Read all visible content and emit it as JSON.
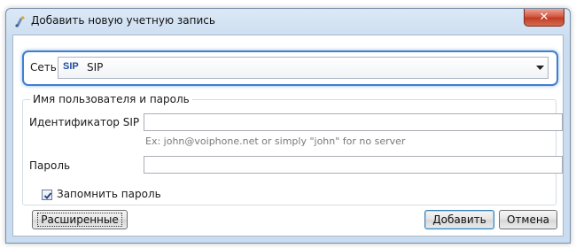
{
  "window": {
    "title": "Добавить новую учетную запись"
  },
  "network": {
    "label": "Сеть",
    "logo_text": "SIP",
    "value": "SIP"
  },
  "credentials": {
    "group_label": "Имя пользователя и пароль",
    "sip_id_label": "Идентификатор SIP",
    "sip_id_value": "",
    "sip_id_hint": "Ex: john@voiphone.net or simply \"john\" for no server",
    "password_label": "Пароль",
    "password_value": "",
    "remember_label": "Запомнить пароль",
    "remember_checked": true
  },
  "buttons": {
    "advanced": "Расширенные",
    "add": "Добавить",
    "cancel": "Отмена"
  }
}
